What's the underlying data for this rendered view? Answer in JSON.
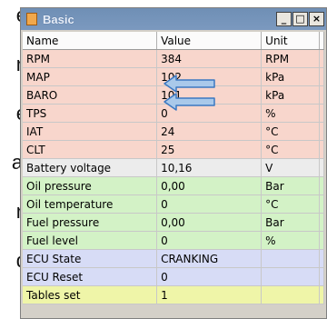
{
  "side_text": [
    "e",
    "n",
    "e",
    "al",
    "n",
    "d"
  ],
  "window": {
    "title": "Basic",
    "controls": {
      "minimize": "_",
      "maximize": "□",
      "close": "×"
    }
  },
  "table": {
    "headers": [
      "Name",
      "Value",
      "Unit"
    ],
    "rows": [
      {
        "name": "RPM",
        "value": "384",
        "unit": "RPM",
        "color": "pink"
      },
      {
        "name": "MAP",
        "value": "102",
        "unit": "kPa",
        "color": "pink"
      },
      {
        "name": "BARO",
        "value": "101",
        "unit": "kPa",
        "color": "pink"
      },
      {
        "name": "TPS",
        "value": "0",
        "unit": "%",
        "color": "pink"
      },
      {
        "name": "IAT",
        "value": "24",
        "unit": "°C",
        "color": "pink"
      },
      {
        "name": "CLT",
        "value": "25",
        "unit": "°C",
        "color": "pink"
      },
      {
        "name": "Battery voltage",
        "value": "10,16",
        "unit": "V",
        "color": "gray"
      },
      {
        "name": "Oil pressure",
        "value": "0,00",
        "unit": "Bar",
        "color": "green"
      },
      {
        "name": "Oil temperature",
        "value": "0",
        "unit": "°C",
        "color": "green"
      },
      {
        "name": "Fuel pressure",
        "value": "0,00",
        "unit": "Bar",
        "color": "green"
      },
      {
        "name": "Fuel level",
        "value": "0",
        "unit": "%",
        "color": "green"
      },
      {
        "name": "ECU State",
        "value": "CRANKING",
        "unit": "",
        "color": "blue"
      },
      {
        "name": "ECU Reset",
        "value": "0",
        "unit": "",
        "color": "blue"
      },
      {
        "name": "Tables set",
        "value": "1",
        "unit": "",
        "color": "yellow"
      }
    ]
  },
  "annotations": {
    "arrow_color": "#a9c9ea",
    "arrow_outline": "#3a78c2",
    "arrow_icon": "left-arrow-icon"
  }
}
